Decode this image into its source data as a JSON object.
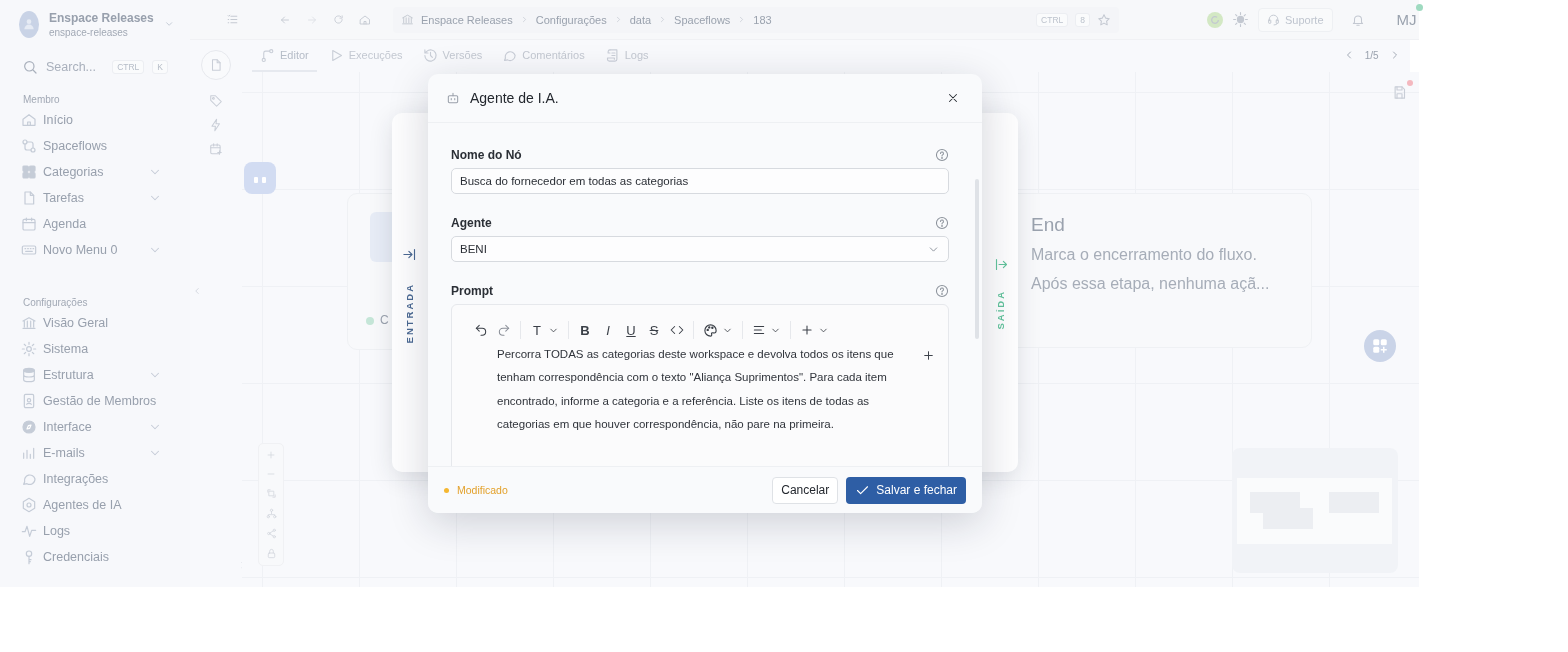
{
  "workspace": {
    "name": "Enspace Releases",
    "slug": "enspace-releases"
  },
  "search": {
    "placeholder": "Search...",
    "keys": [
      "CTRL",
      "K"
    ]
  },
  "sidebar": {
    "sections": [
      {
        "title": "Membro",
        "items": [
          {
            "label": "Início",
            "expandable": false
          },
          {
            "label": "Spaceflows",
            "expandable": false
          },
          {
            "label": "Categorias",
            "expandable": true
          },
          {
            "label": "Tarefas",
            "expandable": true
          },
          {
            "label": "Agenda",
            "expandable": false
          },
          {
            "label": "Novo Menu 0",
            "expandable": true
          }
        ]
      },
      {
        "title": "Configurações",
        "items": [
          {
            "label": "Visão Geral",
            "expandable": false
          },
          {
            "label": "Sistema",
            "expandable": false
          },
          {
            "label": "Estrutura",
            "expandable": true
          },
          {
            "label": "Gestão de Membros",
            "expandable": false
          },
          {
            "label": "Interface",
            "expandable": true
          },
          {
            "label": "E-mails",
            "expandable": true
          },
          {
            "label": "Integrações",
            "expandable": false
          },
          {
            "label": "Agentes de IA",
            "expandable": false
          },
          {
            "label": "Logs",
            "expandable": false
          },
          {
            "label": "Credenciais",
            "expandable": false
          }
        ]
      }
    ]
  },
  "topbar": {
    "breadcrumbs": [
      "Enspace Releases",
      "Configurações",
      "data",
      "Spaceflows",
      "183"
    ],
    "keys": [
      "CTRL",
      "8"
    ],
    "support": "Suporte",
    "avatar": "MJ",
    "online": true
  },
  "tabs": [
    {
      "label": "Editor",
      "selected": true
    },
    {
      "label": "Execuções",
      "selected": false
    },
    {
      "label": "Versões",
      "selected": false
    },
    {
      "label": "Comentários",
      "selected": false
    },
    {
      "label": "Logs",
      "selected": false
    }
  ],
  "pager": "1/5",
  "unsaved_changes": true,
  "canvas": {
    "start_node": {
      "text": "C"
    },
    "end_node": {
      "title": "End",
      "description": [
        "Marca o encerramento do fluxo.",
        "Após essa etapa, nenhuma açã..."
      ]
    }
  },
  "node_panel": {
    "input_label": "ENTRADA",
    "output_label": "SAÍDA"
  },
  "dialog": {
    "title": "Agente de I.A.",
    "fields": [
      {
        "kind": "text",
        "label": "Nome do Nó",
        "value": "Busca do fornecedor em todas as categorias"
      },
      {
        "kind": "select",
        "label": "Agente",
        "value": "BENI"
      },
      {
        "kind": "editor",
        "label": "Prompt",
        "value": "Percorra TODAS as categorias deste workspace e devolva todos os itens que tenham correspondência com o texto \"Aliança Suprimentos\". Para cada item encontrado, informe a categoria e a referência. Liste os itens de todas as categorias em que houver correspondência, não pare na primeira.",
        "format_buttons": [
          {
            "kind": "heading",
            "glyph": "T"
          },
          {
            "kind": "bold",
            "glyph": "B"
          },
          {
            "kind": "italic",
            "glyph": "I"
          },
          {
            "kind": "underline",
            "glyph": "U"
          },
          {
            "kind": "strike",
            "glyph": "S"
          }
        ]
      }
    ],
    "status": "Modificado",
    "buttons": [
      {
        "kind": "secondary",
        "label": "Cancelar"
      },
      {
        "kind": "primary",
        "label": "Salvar e fechar"
      }
    ]
  }
}
